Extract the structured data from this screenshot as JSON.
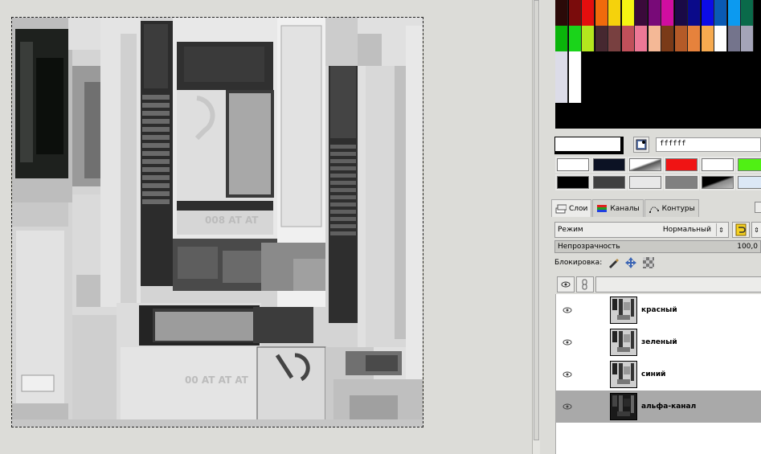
{
  "palette": {
    "row1": [
      "#2b0a08",
      "#7a0c0c",
      "#e40e0e",
      "#f06a0c",
      "#f5d20c",
      "#f5f512",
      "#3a0a3a",
      "#780a78",
      "#d00ea0",
      "#1a0a46",
      "#0a0a8a",
      "#0c0ce6",
      "#0a5ab4",
      "#0c9af0",
      "#0a6a4a"
    ],
    "row2": [
      "#0ab40a",
      "#1ad41a",
      "#b4e61e",
      "#462830",
      "#784040",
      "#c0505a",
      "#ec7896",
      "#f4b896",
      "#7a3a18",
      "#b45a28",
      "#e6823c",
      "#f6aa50",
      "#ffffff",
      "#74748c",
      "#a4a4b8"
    ],
    "row3": [
      "#dcdce8",
      "#ffffff"
    ]
  },
  "foreground_color": "#ffffff",
  "hex_value": "ffffff",
  "presets": [
    {
      "color": "#ffffff"
    },
    {
      "color": "#0c1224"
    },
    {
      "color": "gradient-white"
    },
    {
      "color": "#f01414"
    },
    {
      "color": "#ffffff"
    },
    {
      "color": "#50f014"
    },
    {
      "color": "#000000"
    },
    {
      "color": "#404040"
    },
    {
      "color": "#e8e8e8"
    },
    {
      "color": "#808080"
    },
    {
      "color": "gradient-black"
    },
    {
      "color": "#dce8f6"
    }
  ],
  "tabs": [
    {
      "label": "Слои",
      "icon": "layers-icon"
    },
    {
      "label": "Каналы",
      "icon": "channels-icon"
    },
    {
      "label": "Контуры",
      "icon": "paths-icon"
    }
  ],
  "mode": {
    "label": "Режим",
    "value": "Нормальный"
  },
  "opacity": {
    "label": "Непрозрачность",
    "value": "100,0",
    "percent": 100
  },
  "lock_label": "Блокировка:",
  "layers": [
    {
      "name": "красный",
      "visible": true,
      "selected": false
    },
    {
      "name": "зеленый",
      "visible": true,
      "selected": false
    },
    {
      "name": "синий",
      "visible": true,
      "selected": false
    },
    {
      "name": "альфа-канал",
      "visible": true,
      "selected": true
    }
  ]
}
